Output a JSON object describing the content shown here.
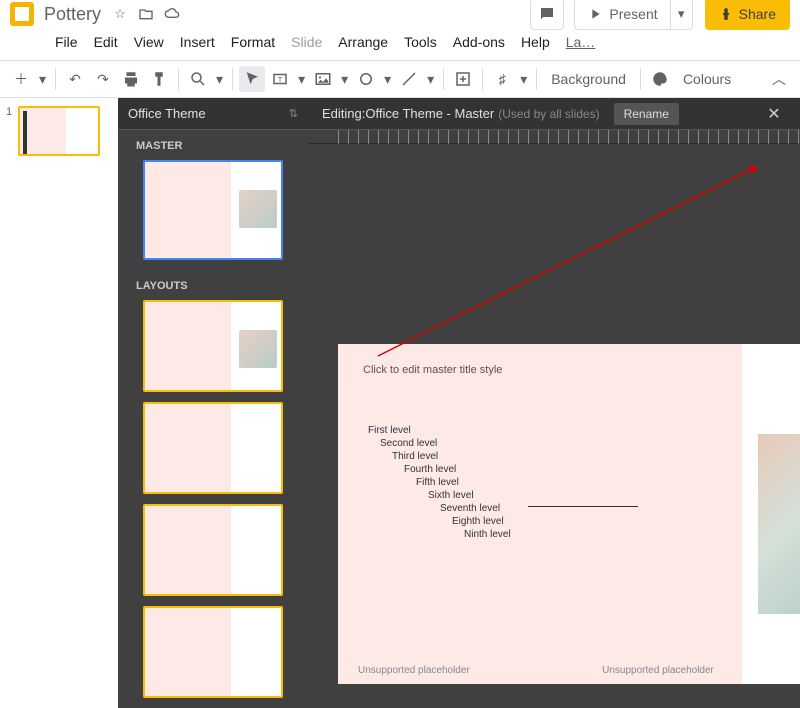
{
  "doc": {
    "title": "Pottery"
  },
  "titlebar_buttons": {
    "present": "Present",
    "share": "Share"
  },
  "menus": [
    "File",
    "Edit",
    "View",
    "Insert",
    "Format",
    "Slide",
    "Arrange",
    "Tools",
    "Add-ons",
    "Help",
    "La…"
  ],
  "toolbar": {
    "background": "Background",
    "colours": "Colours"
  },
  "master_panel": {
    "header": "Office Theme",
    "section_master": "MASTER",
    "section_layouts": "LAYOUTS"
  },
  "editor_header": {
    "prefix": "Editing: ",
    "title": "Office Theme - Master",
    "sub": "(Used by all slides)",
    "rename": "Rename"
  },
  "master_slide": {
    "title_placeholder": "Click to edit master title style",
    "levels": [
      "First level",
      "Second level",
      "Third level",
      "Fourth level",
      "Fifth level",
      "Sixth level",
      "Seventh level",
      "Eighth level",
      "Ninth level"
    ],
    "footer_left": "Unsupported placeholder",
    "footer_center": "Unsupported placeholder",
    "footer_right": "#"
  }
}
